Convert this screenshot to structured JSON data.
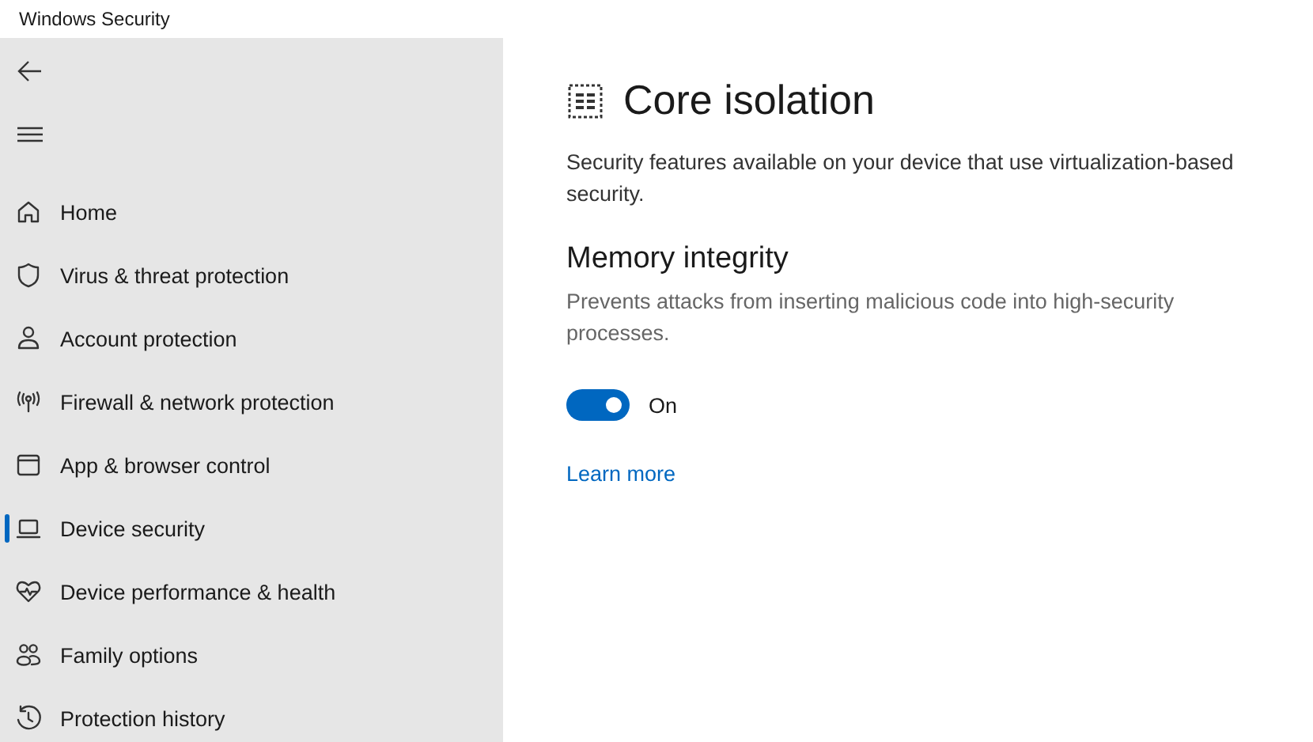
{
  "window": {
    "title": "Windows Security"
  },
  "sidebar": {
    "items": [
      {
        "label": "Home",
        "selected": false
      },
      {
        "label": "Virus & threat protection",
        "selected": false
      },
      {
        "label": "Account protection",
        "selected": false
      },
      {
        "label": "Firewall & network protection",
        "selected": false
      },
      {
        "label": "App & browser control",
        "selected": false
      },
      {
        "label": "Device security",
        "selected": true
      },
      {
        "label": "Device performance & health",
        "selected": false
      },
      {
        "label": "Family options",
        "selected": false
      },
      {
        "label": "Protection history",
        "selected": false
      }
    ]
  },
  "page": {
    "title": "Core isolation",
    "description": "Security features available on your device that use virtualization-based security.",
    "section": {
      "title": "Memory integrity",
      "description": "Prevents attacks from inserting malicious code into high-security processes.",
      "toggle": {
        "on": true,
        "label": "On"
      },
      "link": "Learn more"
    }
  }
}
